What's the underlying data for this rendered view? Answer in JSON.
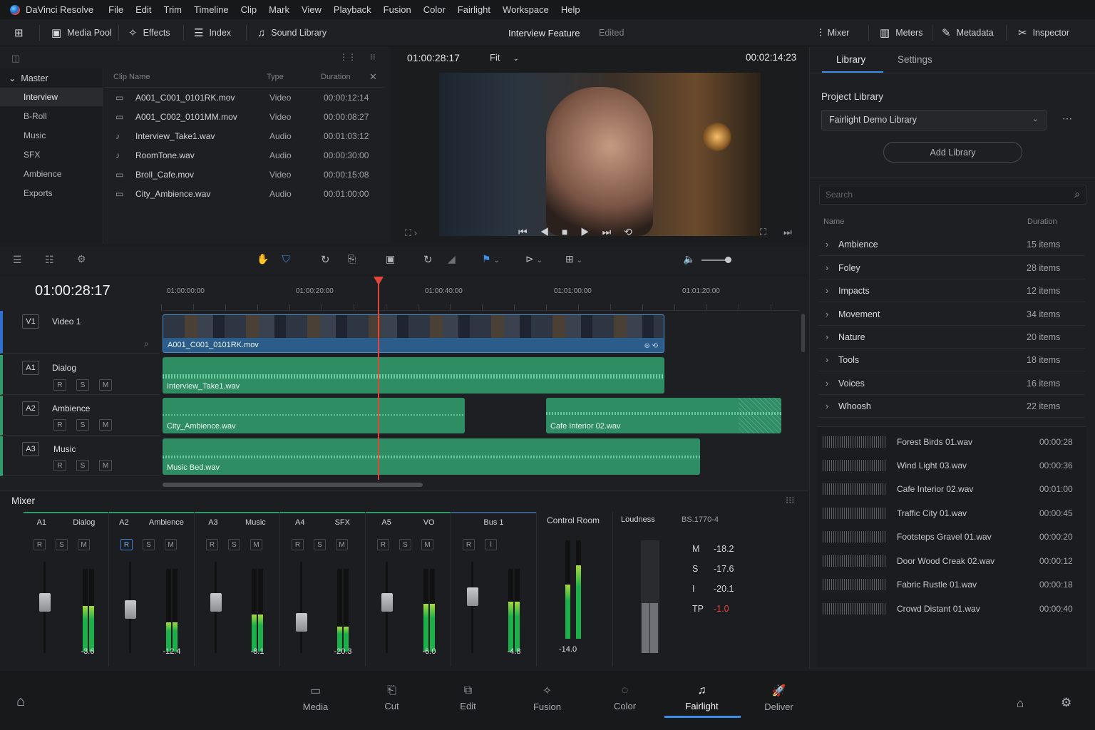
{
  "app": {
    "name": "DaVinci Resolve"
  },
  "menu": [
    "File",
    "Edit",
    "Trim",
    "Timeline",
    "Clip",
    "Mark",
    "View",
    "Playback",
    "Fusion",
    "Color",
    "Fairlight",
    "Workspace",
    "Help"
  ],
  "toolbar": {
    "media_pool": "Media Pool",
    "effects": "Effects",
    "index": "Index",
    "sound_library": "Sound Library",
    "project_title": "Interview Feature",
    "project_status": "Edited",
    "mixer": "Mixer",
    "meters": "Meters",
    "metadata": "Metadata",
    "inspector": "Inspector"
  },
  "bins": {
    "master": "Master",
    "items": [
      "Interview",
      "B-Roll",
      "Music",
      "SFX",
      "Ambience",
      "Exports"
    ],
    "selected": "Interview"
  },
  "clips": {
    "headers": {
      "name": "Clip Name",
      "type": "Type",
      "duration": "Duration"
    },
    "rows": [
      {
        "name": "A001_C001_0101RK.mov",
        "type": "Video",
        "duration": "00:00:12:14"
      },
      {
        "name": "A001_C002_0101MM.mov",
        "type": "Video",
        "duration": "00:00:08:27"
      },
      {
        "name": "Interview_Take1.wav",
        "type": "Audio",
        "duration": "00:01:03:12"
      },
      {
        "name": "RoomTone.wav",
        "type": "Audio",
        "duration": "00:00:30:00"
      },
      {
        "name": "Broll_Cafe.mov",
        "type": "Video",
        "duration": "00:00:15:08"
      },
      {
        "name": "City_Ambience.wav",
        "type": "Audio",
        "duration": "00:01:00:00"
      }
    ]
  },
  "viewer": {
    "timecode": "01:00:28:17",
    "zoom": "Fit",
    "duration": "00:02:14:23"
  },
  "timeline": {
    "timecode": "01:00:28:17",
    "ruler": [
      "01:00:00:00",
      "01:00:20:00",
      "01:00:40:00",
      "01:01:00:00",
      "01:01:20:00"
    ],
    "tracks": [
      {
        "id": "V1",
        "name": "Video 1"
      },
      {
        "id": "A1",
        "name": "Dialog"
      },
      {
        "id": "A2",
        "name": "Ambience"
      },
      {
        "id": "A3",
        "name": "Music"
      }
    ],
    "rsm": [
      "R",
      "S",
      "M"
    ],
    "clips": {
      "v1": "A001_C001_0101RK.mov",
      "a1": "Interview_Take1.wav",
      "a2a": "City_Ambience.wav",
      "a2b": "Cafe Interior 02.wav",
      "a3": "Music Bed.wav"
    }
  },
  "mixer": {
    "title": "Mixer",
    "channels": [
      {
        "id": "A1",
        "name": "Dialog",
        "value": "-3.6",
        "level": 0.55
      },
      {
        "id": "A2",
        "name": "Ambience",
        "value": "-12.4",
        "level": 0.35
      },
      {
        "id": "A3",
        "name": "Music",
        "value": "-8.1",
        "level": 0.45
      },
      {
        "id": "A4",
        "name": "SFX",
        "value": "-20.3",
        "level": 0.3
      },
      {
        "id": "A5",
        "name": "VO",
        "value": "-6.0",
        "level": 0.58
      },
      {
        "id": "",
        "name": "Bus 1",
        "value": "-4.8",
        "level": 0.6
      }
    ],
    "control_room": {
      "title": "Control Room",
      "value": "-14.0"
    },
    "loudness": {
      "title": "Loudness",
      "standard": "BS.1770-4",
      "rows": [
        {
          "k": "M",
          "v": "-18.2"
        },
        {
          "k": "S",
          "v": "-17.6"
        },
        {
          "k": "I",
          "v": "-20.1"
        },
        {
          "k": "TP",
          "v": "-1.0"
        }
      ]
    }
  },
  "library": {
    "tabs": [
      "Library",
      "Settings"
    ],
    "project_library_label": "Project Library",
    "selected_library": "Fairlight Demo Library",
    "add_library": "Add Library",
    "search_placeholder": "Search",
    "headers": {
      "name": "Name",
      "duration": "Duration"
    },
    "categories": [
      {
        "name": "Ambience",
        "count": "15 items"
      },
      {
        "name": "Foley",
        "count": "28 items"
      },
      {
        "name": "Impacts",
        "count": "12 items"
      },
      {
        "name": "Movement",
        "count": "34 items"
      },
      {
        "name": "Nature",
        "count": "20 items"
      },
      {
        "name": "Tools",
        "count": "18 items"
      },
      {
        "name": "Voices",
        "count": "16 items"
      },
      {
        "name": "Whoosh",
        "count": "22 items"
      }
    ],
    "files": [
      {
        "name": "Forest Birds 01.wav",
        "duration": "00:00:28"
      },
      {
        "name": "Wind Light 03.wav",
        "duration": "00:00:36"
      },
      {
        "name": "Cafe Interior 02.wav",
        "duration": "00:01:00"
      },
      {
        "name": "Traffic City 01.wav",
        "duration": "00:00:45"
      },
      {
        "name": "Footsteps Gravel 01.wav",
        "duration": "00:00:20"
      },
      {
        "name": "Door Wood Creak 02.wav",
        "duration": "00:00:12"
      },
      {
        "name": "Fabric Rustle 01.wav",
        "duration": "00:00:18"
      },
      {
        "name": "Crowd Distant 01.wav",
        "duration": "00:00:40"
      }
    ]
  },
  "pages": [
    "Media",
    "Cut",
    "Edit",
    "Fusion",
    "Color",
    "Fairlight",
    "Deliver"
  ],
  "active_page": "Fairlight"
}
